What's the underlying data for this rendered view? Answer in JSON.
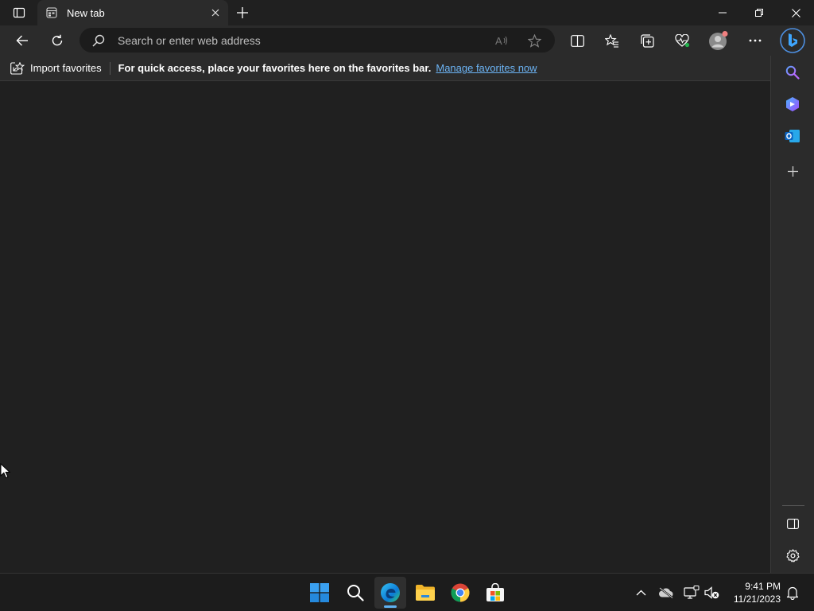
{
  "tabs": [
    {
      "title": "New tab",
      "active": true
    }
  ],
  "window_controls": {
    "minimize": "minimize",
    "restore": "restore",
    "close": "close"
  },
  "address_bar": {
    "placeholder": "Search or enter web address",
    "value": ""
  },
  "favorites_bar": {
    "import_label": "Import favorites",
    "message": "For quick access, place your favorites here on the favorites bar.",
    "manage_link": "Manage favorites now"
  },
  "sidebar": {
    "items": [
      "search-icon",
      "copilot-icon",
      "outlook-icon",
      "add-icon"
    ],
    "bottom": [
      "hide-sidebar-icon",
      "settings-icon"
    ]
  },
  "taskbar": {
    "apps": [
      "windows-start",
      "search",
      "edge",
      "file-explorer",
      "chrome",
      "microsoft-store"
    ],
    "active_app": "edge"
  },
  "clock": {
    "time": "9:41 PM",
    "date": "11/21/2023"
  },
  "colors": {
    "accent": "#5fb2f2",
    "link": "#6cb4f5",
    "background": "#202020",
    "chrome": "#2b2b2b"
  }
}
